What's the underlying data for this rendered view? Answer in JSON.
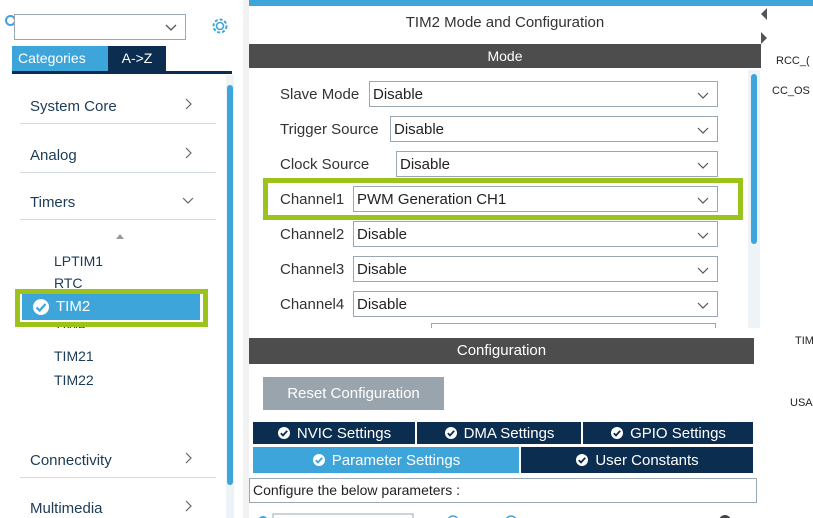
{
  "search": {
    "value": "",
    "placeholder": ""
  },
  "category_tabs": {
    "categories": "Categories",
    "atoz": "A->Z"
  },
  "categories": [
    {
      "label": "System Core",
      "expanded": false
    },
    {
      "label": "Analog",
      "expanded": false
    },
    {
      "label": "Timers",
      "expanded": true
    },
    {
      "label": "Connectivity",
      "expanded": false
    },
    {
      "label": "Multimedia",
      "expanded": false
    }
  ],
  "timers": [
    "LPTIM1",
    "RTC",
    "TIM2",
    "TIM6",
    "TIM21",
    "TIM22"
  ],
  "panel": {
    "title": "TIM2 Mode and Configuration",
    "mode_header": "Mode",
    "config_header": "Configuration"
  },
  "mode_fields": [
    {
      "label": "Slave Mode",
      "value": "Disable"
    },
    {
      "label": "Trigger Source",
      "value": "Disable"
    },
    {
      "label": "Clock Source",
      "value": "Disable"
    },
    {
      "label": "Channel1",
      "value": "PWM Generation CH1"
    },
    {
      "label": "Channel2",
      "value": "Disable"
    },
    {
      "label": "Channel3",
      "value": "Disable"
    },
    {
      "label": "Channel4",
      "value": "Disable"
    }
  ],
  "config": {
    "reset_button": "Reset Configuration",
    "tabs_row1": [
      "NVIC Settings",
      "DMA Settings",
      "GPIO Settings"
    ],
    "tabs_row2": [
      "Parameter Settings",
      "User Constants"
    ],
    "description": "Configure the below parameters :"
  },
  "right_labels": [
    "RCC_(",
    "CC_OS",
    "TIM",
    "USA"
  ],
  "colors": {
    "accent": "#3ea5da",
    "navy": "#0b2d4f",
    "highlight": "#9bc31b",
    "header": "#4d4d4d"
  }
}
